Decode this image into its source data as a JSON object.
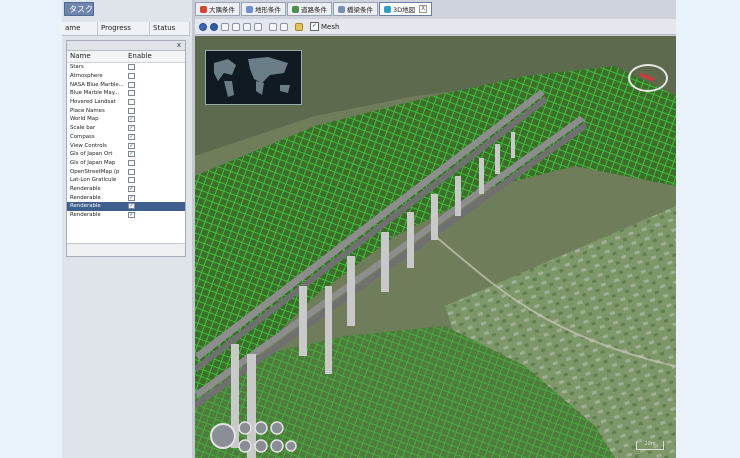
{
  "left": {
    "task_tab": "タスク",
    "task_columns": [
      "ame",
      "Progress",
      "Status"
    ]
  },
  "layer_panel": {
    "close": "x",
    "header_name": "Name",
    "header_enable": "Enable",
    "layers": [
      {
        "name": "Stars",
        "checked": false,
        "selected": false
      },
      {
        "name": "Atmosphere",
        "checked": false,
        "selected": false
      },
      {
        "name": "NASA Blue Marble...",
        "checked": false,
        "selected": false
      },
      {
        "name": "Blue Marble May...",
        "checked": false,
        "selected": false
      },
      {
        "name": "Hovered Landsat",
        "checked": false,
        "selected": false
      },
      {
        "name": "Place Names",
        "checked": false,
        "selected": false
      },
      {
        "name": "World Map",
        "checked": true,
        "selected": false
      },
      {
        "name": "Scale bar",
        "checked": true,
        "selected": false
      },
      {
        "name": "Compass",
        "checked": true,
        "selected": false
      },
      {
        "name": "View Controls",
        "checked": true,
        "selected": false
      },
      {
        "name": "GIs of Japan Ort",
        "checked": true,
        "selected": false
      },
      {
        "name": "GIs of Japan Map",
        "checked": false,
        "selected": false
      },
      {
        "name": "OpenStreetMap (p",
        "checked": false,
        "selected": false
      },
      {
        "name": "Lat-Lon Graticule",
        "checked": false,
        "selected": false
      },
      {
        "name": "Renderable",
        "checked": true,
        "selected": false
      },
      {
        "name": "Renderable",
        "checked": true,
        "selected": false
      },
      {
        "name": "Renderable",
        "checked": true,
        "selected": true
      },
      {
        "name": "Renderable",
        "checked": true,
        "selected": false
      }
    ]
  },
  "tabs": [
    {
      "label": "大隅条件",
      "color": "#d9442e",
      "active": false,
      "closable": false
    },
    {
      "label": "地形条件",
      "color": "#6b8fd1",
      "active": false,
      "closable": false
    },
    {
      "label": "道路条件",
      "color": "#4a8f4a",
      "active": false,
      "closable": false
    },
    {
      "label": "橋梁条件",
      "color": "#7d8fb0",
      "active": false,
      "closable": false
    },
    {
      "label": "3D地図",
      "color": "#2fa0c8",
      "active": true,
      "closable": true
    }
  ],
  "toolbar": {
    "mesh_label": "Mesh",
    "mesh_checked": true
  },
  "view": {
    "scale_label": "20m"
  },
  "colors": {
    "selection": "#3f5f8c",
    "terrain_mesh": "#3fd43f"
  }
}
